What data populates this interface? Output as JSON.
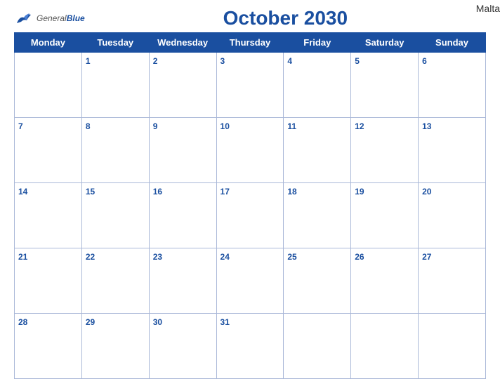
{
  "header": {
    "logo_general": "General",
    "logo_blue": "Blue",
    "title": "October 2030",
    "country": "Malta"
  },
  "calendar": {
    "days_of_week": [
      "Monday",
      "Tuesday",
      "Wednesday",
      "Thursday",
      "Friday",
      "Saturday",
      "Sunday"
    ],
    "weeks": [
      [
        null,
        1,
        2,
        3,
        4,
        5,
        6
      ],
      [
        7,
        8,
        9,
        10,
        11,
        12,
        13
      ],
      [
        14,
        15,
        16,
        17,
        18,
        19,
        20
      ],
      [
        21,
        22,
        23,
        24,
        25,
        26,
        27
      ],
      [
        28,
        29,
        30,
        31,
        null,
        null,
        null
      ]
    ]
  }
}
